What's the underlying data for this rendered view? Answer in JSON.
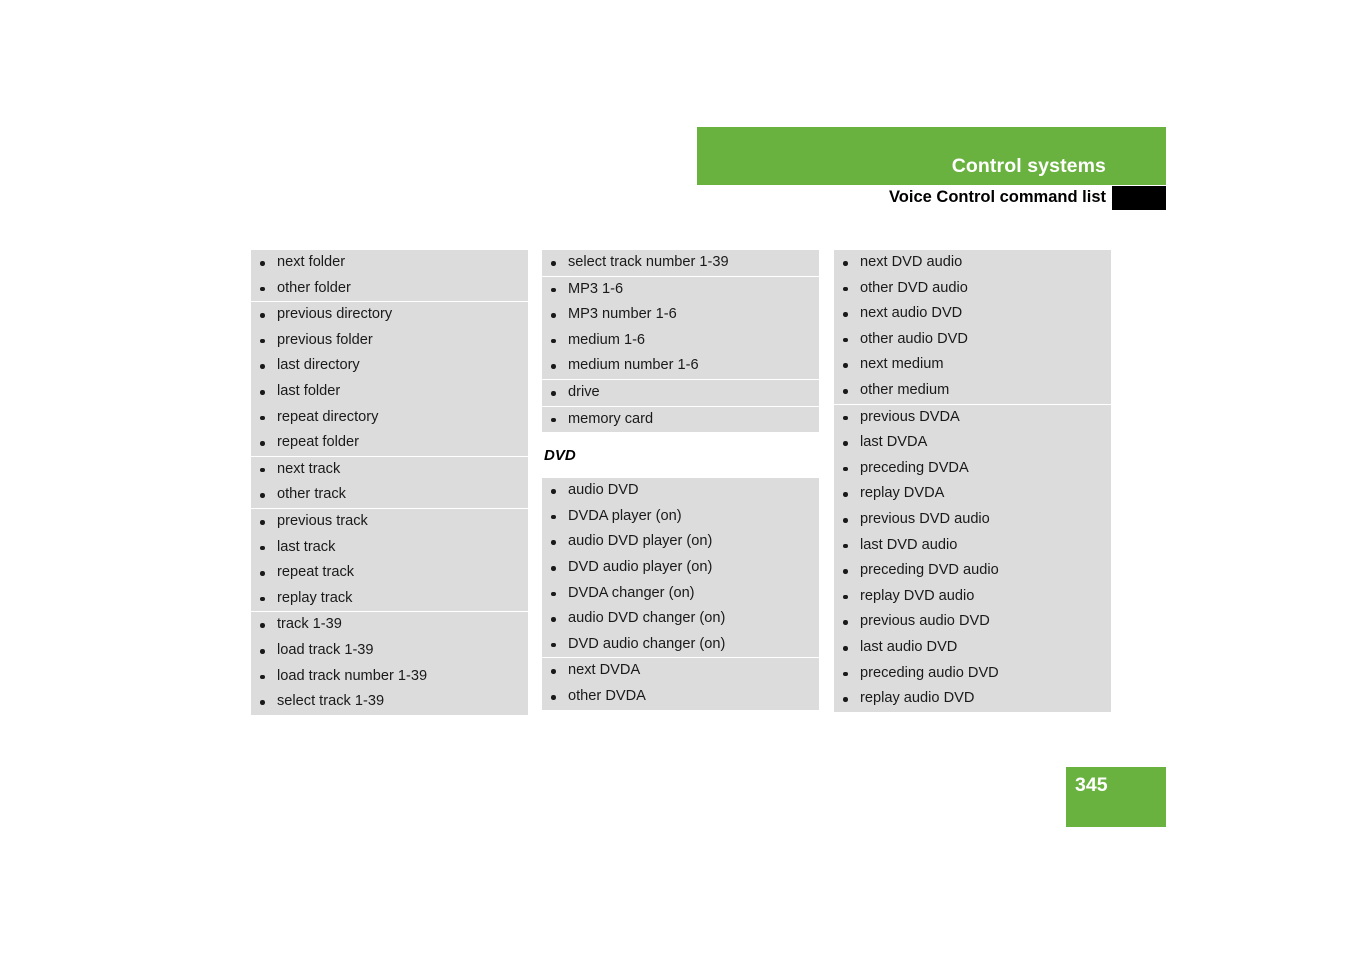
{
  "header": {
    "band_title": "Control systems",
    "sub_title": "Voice Control command list",
    "band_color": "#6ab240",
    "marker_color": "#000000"
  },
  "footer": {
    "page_number": "345",
    "tab_color": "#6ab240"
  },
  "columns": [
    {
      "id": "column-1",
      "groups": [
        {
          "items": [
            "next folder",
            "other folder"
          ]
        },
        {
          "items": [
            "previous directory",
            "previous folder",
            "last directory",
            "last folder",
            "repeat directory",
            "repeat folder"
          ]
        },
        {
          "items": [
            "next track",
            "other track"
          ]
        },
        {
          "items": [
            "previous track",
            "last track",
            "repeat track",
            "replay track"
          ]
        },
        {
          "items": [
            "track  1-39",
            "load track  1-39",
            "load track number  1-39",
            "select track  1-39"
          ]
        }
      ]
    },
    {
      "id": "column-2",
      "groups": [
        {
          "items": [
            "select track number 1-39"
          ]
        },
        {
          "items": [
            "MP3  1-6",
            "MP3 number  1-6",
            "medium  1-6",
            "medium number  1-6"
          ]
        },
        {
          "items": [
            "drive"
          ]
        },
        {
          "items": [
            "memory card"
          ]
        }
      ],
      "heading": "DVD",
      "groups_after_heading": [
        {
          "items": [
            "audio DVD",
            "DVDA player (on)",
            "audio DVD player (on)",
            "DVD audio player (on)",
            "DVDA changer (on)",
            "audio DVD changer (on)",
            "DVD audio changer (on)"
          ]
        },
        {
          "items": [
            "next DVDA",
            "other DVDA"
          ]
        }
      ]
    },
    {
      "id": "column-3",
      "groups": [
        {
          "items": [
            "next DVD audio",
            "other DVD audio",
            "next audio DVD",
            "other audio DVD",
            "next medium",
            "other medium"
          ]
        },
        {
          "items": [
            "previous DVDA",
            "last DVDA",
            "preceding DVDA",
            "replay DVDA",
            "previous DVD audio",
            "last DVD audio",
            "preceding DVD audio",
            "replay DVD audio",
            "previous audio DVD",
            "last audio DVD",
            "preceding audio DVD",
            "replay audio DVD"
          ]
        }
      ]
    }
  ]
}
